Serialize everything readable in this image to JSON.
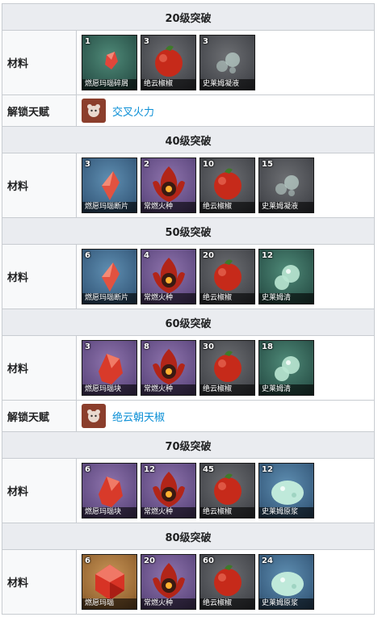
{
  "colors": {
    "link": "#0b8fd6",
    "header_bg": "#eaecf0",
    "label_bg": "#f8f9fa",
    "border": "#c8ccd1"
  },
  "sections": [
    {
      "title": "20级突破",
      "material_label": "材料",
      "materials": [
        {
          "qty": "1",
          "name": "燃愿玛瑙碎屑",
          "icon": "agate-sliver-icon",
          "bg": "green"
        },
        {
          "qty": "3",
          "name": "绝云椒椒",
          "icon": "jueyun-chili-icon",
          "bg": "gray"
        },
        {
          "qty": "3",
          "name": "史莱姆凝液",
          "icon": "slime-condensate-icon",
          "bg": "gray"
        }
      ],
      "talent": {
        "label": "解锁天赋",
        "name": "交叉火力",
        "icon": "crossfire-talent-icon"
      }
    },
    {
      "title": "40级突破",
      "material_label": "材料",
      "materials": [
        {
          "qty": "3",
          "name": "燃愿玛瑙断片",
          "icon": "agate-fragment-icon",
          "bg": "blue"
        },
        {
          "qty": "2",
          "name": "常燃火种",
          "icon": "everflame-seed-icon",
          "bg": "purple"
        },
        {
          "qty": "10",
          "name": "绝云椒椒",
          "icon": "jueyun-chili-icon",
          "bg": "gray"
        },
        {
          "qty": "15",
          "name": "史莱姆凝液",
          "icon": "slime-condensate-icon",
          "bg": "gray"
        }
      ]
    },
    {
      "title": "50级突破",
      "material_label": "材料",
      "materials": [
        {
          "qty": "6",
          "name": "燃愿玛瑙断片",
          "icon": "agate-fragment-icon",
          "bg": "blue"
        },
        {
          "qty": "4",
          "name": "常燃火种",
          "icon": "everflame-seed-icon",
          "bg": "purple"
        },
        {
          "qty": "20",
          "name": "绝云椒椒",
          "icon": "jueyun-chili-icon",
          "bg": "gray"
        },
        {
          "qty": "12",
          "name": "史莱姆清",
          "icon": "slime-secretions-icon",
          "bg": "green"
        }
      ]
    },
    {
      "title": "60级突破",
      "material_label": "材料",
      "materials": [
        {
          "qty": "3",
          "name": "燃愿玛瑙块",
          "icon": "agate-chunk-icon",
          "bg": "purple"
        },
        {
          "qty": "8",
          "name": "常燃火种",
          "icon": "everflame-seed-icon",
          "bg": "purple"
        },
        {
          "qty": "30",
          "name": "绝云椒椒",
          "icon": "jueyun-chili-icon",
          "bg": "gray"
        },
        {
          "qty": "18",
          "name": "史莱姆清",
          "icon": "slime-secretions-icon",
          "bg": "green"
        }
      ],
      "talent": {
        "label": "解锁天赋",
        "name": "绝云朝天椒",
        "icon": "chili-talent-icon"
      }
    },
    {
      "title": "70级突破",
      "material_label": "材料",
      "materials": [
        {
          "qty": "6",
          "name": "燃愿玛瑙块",
          "icon": "agate-chunk-icon",
          "bg": "purple"
        },
        {
          "qty": "12",
          "name": "常燃火种",
          "icon": "everflame-seed-icon",
          "bg": "purple"
        },
        {
          "qty": "45",
          "name": "绝云椒椒",
          "icon": "jueyun-chili-icon",
          "bg": "gray"
        },
        {
          "qty": "12",
          "name": "史莱姆原浆",
          "icon": "slime-concentrate-icon",
          "bg": "blue"
        }
      ]
    },
    {
      "title": "80级突破",
      "material_label": "材料",
      "materials": [
        {
          "qty": "6",
          "name": "燃愿玛瑙",
          "icon": "agate-gemstone-icon",
          "bg": "gold"
        },
        {
          "qty": "20",
          "name": "常燃火种",
          "icon": "everflame-seed-icon",
          "bg": "purple"
        },
        {
          "qty": "60",
          "name": "绝云椒椒",
          "icon": "jueyun-chili-icon",
          "bg": "gray"
        },
        {
          "qty": "24",
          "name": "史莱姆原浆",
          "icon": "slime-concentrate-icon",
          "bg": "blue"
        }
      ]
    }
  ]
}
